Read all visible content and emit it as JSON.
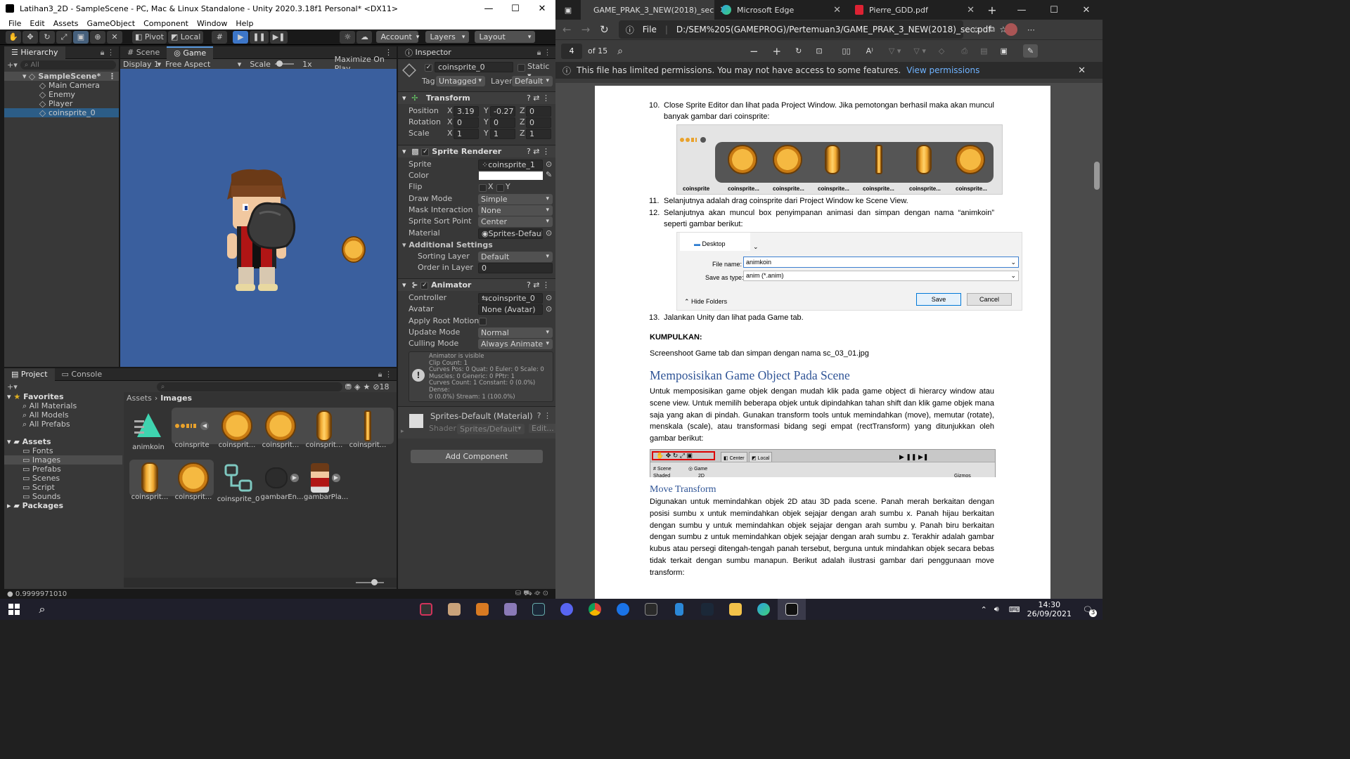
{
  "unity": {
    "title": "Latihan3_2D - SampleScene - PC, Mac & Linux Standalone - Unity 2020.3.18f1 Personal* <DX11>",
    "menu": [
      "File",
      "Edit",
      "Assets",
      "GameObject",
      "Component",
      "Window",
      "Help"
    ],
    "toolbar": {
      "pivot": "Pivot",
      "local": "Local",
      "account": "Account",
      "layers": "Layers",
      "layout": "Layout"
    },
    "hierarchy": {
      "tab": "Hierarchy",
      "search_placeholder": "All",
      "scene": "SampleScene*",
      "items": [
        "Main Camera",
        "Enemy",
        "Player",
        "coinsprite_0"
      ]
    },
    "game": {
      "tabs": [
        "Scene",
        "Game"
      ],
      "display": "Display 1",
      "aspect": "Free Aspect",
      "scale_label": "Scale",
      "scale_value": "1x",
      "maximize": "Maximize On Play",
      "bg_color": "#3a5f9e"
    },
    "inspector": {
      "tab": "Inspector",
      "object_name": "coinsprite_0",
      "static": "Static",
      "tag_label": "Tag",
      "tag": "Untagged",
      "layer_label": "Layer",
      "layer": "Default",
      "transform": {
        "title": "Transform",
        "position_label": "Position",
        "rotation_label": "Rotation",
        "scale_label": "Scale",
        "position": [
          "3.19",
          "-0.27",
          "0"
        ],
        "rotation": [
          "0",
          "0",
          "0"
        ],
        "scale": [
          "1",
          "1",
          "1"
        ]
      },
      "sprite_renderer": {
        "title": "Sprite Renderer",
        "sprite_label": "Sprite",
        "sprite": "coinsprite_1",
        "color_label": "Color",
        "flip_label": "Flip",
        "flip_x": "X",
        "flip_y": "Y",
        "draw_mode_label": "Draw Mode",
        "draw_mode": "Simple",
        "mask_label": "Mask Interaction",
        "mask": "None",
        "sort_point_label": "Sprite Sort Point",
        "sort_point": "Center",
        "material_label": "Material",
        "material": "Sprites-Default",
        "additional": "Additional Settings",
        "sorting_layer_label": "Sorting Layer",
        "sorting_layer": "Default",
        "order_label": "Order in Layer",
        "order": "0"
      },
      "animator": {
        "title": "Animator",
        "controller_label": "Controller",
        "controller": "coinsprite_0",
        "avatar_label": "Avatar",
        "avatar": "None (Avatar)",
        "root_motion_label": "Apply Root Motion",
        "update_label": "Update Mode",
        "update": "Normal",
        "culling_label": "Culling Mode",
        "culling": "Always Animate",
        "info": [
          "Animator is visible",
          "Clip Count: 1",
          "Curves Pos: 0 Quat: 0 Euler: 0 Scale: 0",
          "Muscles: 0 Generic: 0 PPtr: 1",
          "Curves Count: 1 Constant: 0 (0.0%) Dense:",
          "0 (0.0%) Stream: 1 (100.0%)"
        ]
      },
      "material": {
        "name": "Sprites-Default (Material)",
        "shader_label": "Shader",
        "shader": "Sprites/Default",
        "edit": "Edit..."
      },
      "add_component": "Add Component"
    },
    "project": {
      "tabs": [
        "Project",
        "Console"
      ],
      "hidden_count": "18",
      "favorites": "Favorites",
      "fav_items": [
        "All Materials",
        "All Models",
        "All Prefabs"
      ],
      "assets_root": "Assets",
      "folders": [
        "Fonts",
        "Images",
        "Prefabs",
        "Scenes",
        "Script",
        "Sounds"
      ],
      "packages": "Packages",
      "breadcrumb": [
        "Assets",
        "Images"
      ],
      "assets_row1": [
        "animkoin",
        "coinsprite",
        "coinsprit...",
        "coinsprit...",
        "coinsprit...",
        "coinsprit..."
      ],
      "assets_row2": [
        "coinsprit...",
        "coinsprit...",
        "coinsprite_0",
        "gambarEn...",
        "gambarPla..."
      ]
    },
    "status": "0.9999971010"
  },
  "edge": {
    "tabs": [
      {
        "label": "GAME_PRAK_3_NEW(2018)_sec"
      },
      {
        "label": "Microsoft Edge"
      },
      {
        "label": "Pierre_GDD.pdf"
      }
    ],
    "url_scheme": "File",
    "url": "D:/SEM%205(GAMEPROG)/Pertemuan3/GAME_PRAK_3_NEW(2018)_sec.pdf",
    "page_current": "4",
    "page_total": "of 15",
    "notice": "This file has limited permissions. You may not have access to some features.",
    "notice_link": "View permissions"
  },
  "pdf": {
    "item10_num": "10.",
    "item10": "Close Sprite Editor dan lihat pada Project Window. Jika pemotongan berhasil maka akan muncul banyak gambar dari coinsprite:",
    "fig1_labels": [
      "coinsprite",
      "coinsprite...",
      "coinsprite...",
      "coinsprite...",
      "coinsprite...",
      "coinsprite...",
      "coinsprite..."
    ],
    "item11_num": "11.",
    "item11": "Selanjutnya adalah drag coinsprite dari Project Window ke Scene View.",
    "item12_num": "12.",
    "item12": "Selanjutnya akan muncul box penyimpanan animasi dan simpan dengan nama “animkoin” seperti gambar berikut:",
    "dialog": {
      "desktop": "Desktop",
      "file_name_label": "File name:",
      "file_name": "animkoin",
      "save_type_label": "Save as type:",
      "save_type": "anim (*.anim)",
      "hide": "Hide Folders",
      "save": "Save",
      "cancel": "Cancel"
    },
    "item13_num": "13.",
    "item13": "Jalankan Unity dan lihat pada Game tab.",
    "kumpulkan": "KUMPULKAN:",
    "screenshot": "Screenshoot Game tab dan simpan dengan nama sc_03_01.jpg",
    "h1": "Memposisikan Game Object Pada Scene",
    "para1": "Untuk memposisikan game objek dengan mudah klik pada game object di hierarcy window atau scene view. Untuk memilih beberapa objek untuk dipindahkan tahan shift dan klik game objek mana saja yang akan di pindah. Gunakan transform tools untuk memindahkan (move), memutar (rotate), menskala (scale), atau transformasi bidang segi empat (rectTransform) yang ditunjukkan oleh gambar berikut:",
    "fig3": {
      "center": "Center",
      "local": "Local",
      "scene": "Scene",
      "game": "Game",
      "shaded": "Shaded",
      "mode2d": "2D",
      "gizmos": "Gizmos"
    },
    "h2": "Move Transform",
    "para2": "Digunakan untuk memindahkan objek 2D atau 3D pada scene. Panah merah berkaitan dengan posisi sumbu x untuk memindahkan objek sejajar dengan arah sumbu x. Panah hijau berkaitan dengan sumbu y untuk memindahkan objek sejajar dengan arah sumbu y. Panah biru berkaitan dengan sumbu z untuk memindahkan objek sejajar dengan arah sumbu z. Terakhir adalah gambar kubus atau persegi ditengah-tengah panah tersebut, berguna untuk mindahkan objek secara bebas tidak terkait dengan sumbu manapun. Berikut adalah ilustrasi gambar dari penggunaan move transform:"
  },
  "taskbar": {
    "time": "14:30",
    "date": "26/09/2021",
    "notif": "3"
  }
}
